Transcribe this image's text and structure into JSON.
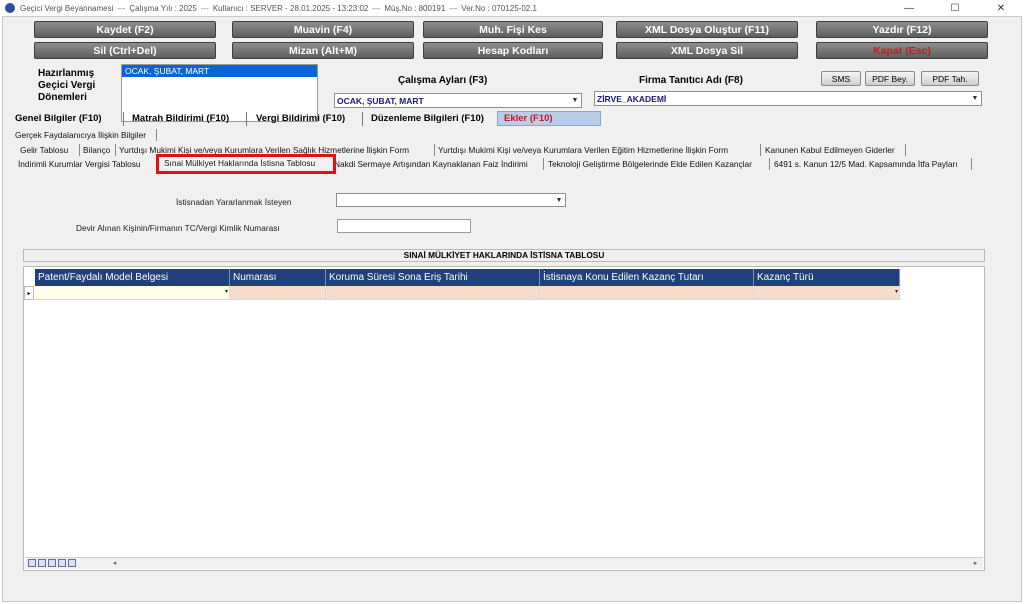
{
  "titlebar": {
    "app_name": "Geçici Vergi Beyannamesi",
    "year": "Çalışma Yılı : 2025",
    "user": "Kullanıcı : SERVER - 28.01.2025 - 13:23:02",
    "client_no": "Müş.No : 800191",
    "version": "Ver.No : 070125-02.1",
    "minimize": "—",
    "maximize": "☐",
    "close": "✕"
  },
  "toolbar": {
    "row1": [
      "Kaydet (F2)",
      "Muavin (F4)",
      "Muh. Fişi Kes",
      "XML Dosya Oluştur (F11)",
      "Yazdır (F12)"
    ],
    "row2": [
      "Sil (Ctrl+Del)",
      "Mizan (Alt+M)",
      "Hesap Kodları",
      "XML Dosya Sil",
      "Kapat (Esc)"
    ]
  },
  "periods": {
    "label_line1": "Hazırlanmış",
    "label_line2": "Geçici Vergi",
    "label_line3": "Dönemleri",
    "selected": "OCAK, ŞUBAT, MART"
  },
  "work_months": {
    "label": "Çalışma Ayları (F3)",
    "value": "OCAK, ŞUBAT, MART"
  },
  "firm": {
    "label": "Firma Tanıtıcı Adı (F8)",
    "value": "ZİRVE_AKADEMİ"
  },
  "small_buttons": [
    "SMS",
    "PDF Bey.",
    "PDF Tah."
  ],
  "main_tabs": [
    "Genel Bilgiler (F10)",
    "Matrah Bildirimi (F10)",
    "Vergi Bildirimi (F10)",
    "Düzenleme Bilgileri (F10)",
    "Ekler (F10)"
  ],
  "sub_tabs_row1": [
    "Gerçek Faydalanıcıya İlişkin Bilgiler"
  ],
  "sub_tabs_row2": [
    "Gelir Tablosu",
    "Bilanço",
    "Yurtdışı Mukimi Kişi ve/veya Kurumlara Verilen Sağlık Hizmetlerine İlişkin Form",
    "Yurtdışı Mukimi Kişi ve/veya Kurumlara Verilen Eğitim Hizmetlerine İlişkin Form",
    "Kanunen Kabul Edilmeyen Giderler"
  ],
  "sub_tabs_row3": [
    "İndirimli Kurumlar Vergisi Tablosu",
    "Sınai Mülkiyet Haklarında İstisna Tablosu",
    "Nakdi Sermaye Artışından Kaynaklanan Faiz İndirimi",
    "Teknoloji Geliştirme Bölgelerinde Elde Edilen Kazançlar",
    "6491 s. Kanun 12/5 Mad. Kapsamında İtfa Payları"
  ],
  "form": {
    "exemption_label": "İstisnadan Yararlanmak İsteyen",
    "exemption_value": "",
    "transferor_label": "Devir Alınan Kişinin/Firmanın TC/Vergi Kimlik Numarası",
    "transferor_value": ""
  },
  "table": {
    "title": "SINAİ MÜLKİYET HAKLARINDA İSTİSNA TABLOSU",
    "columns": [
      "Patent/Faydalı Model Belgesi",
      "Numarası",
      "Koruma Süresi Sona Eriş Tarihi",
      "İstisnaya Konu Edilen Kazanç Tutarı",
      "Kazanç Türü"
    ],
    "row_indicator": "▸",
    "dropdown_arrow": "▾"
  },
  "colors": {
    "button_gray": "#6e6e6e",
    "header_blue": "#203f7c",
    "cell_peach": "#f8dccb",
    "selection_blue": "#0a64d8",
    "highlight_red": "#e01010",
    "exit_red": "#c81a1a"
  },
  "icons": {
    "app": "app-logo-icon",
    "minimize": "minimize-icon",
    "maximize": "maximize-icon",
    "close": "close-icon",
    "dropdown": "chevron-down-icon",
    "row": "row-pointer-icon"
  }
}
